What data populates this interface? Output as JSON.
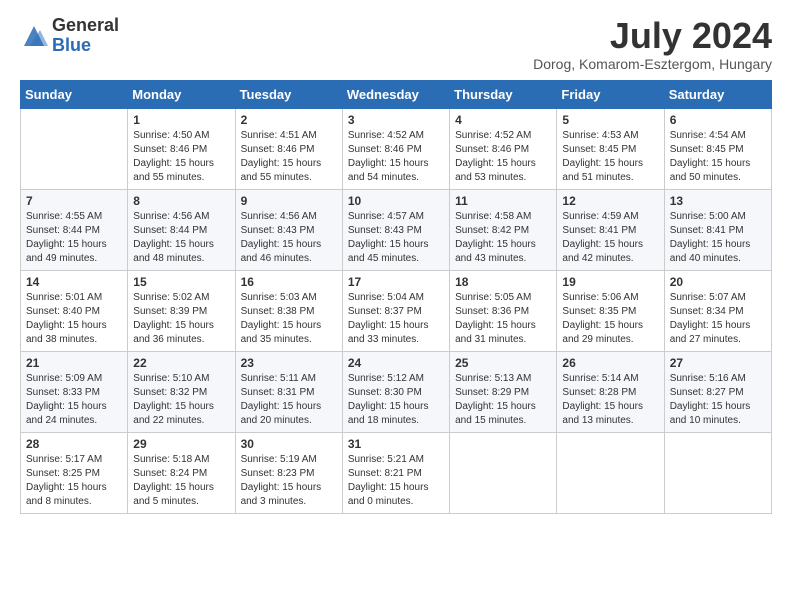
{
  "header": {
    "logo_general": "General",
    "logo_blue": "Blue",
    "month_year": "July 2024",
    "location": "Dorog, Komarom-Esztergom, Hungary"
  },
  "weekdays": [
    "Sunday",
    "Monday",
    "Tuesday",
    "Wednesday",
    "Thursday",
    "Friday",
    "Saturday"
  ],
  "weeks": [
    [
      {
        "day": "",
        "info": ""
      },
      {
        "day": "1",
        "info": "Sunrise: 4:50 AM\nSunset: 8:46 PM\nDaylight: 15 hours\nand 55 minutes."
      },
      {
        "day": "2",
        "info": "Sunrise: 4:51 AM\nSunset: 8:46 PM\nDaylight: 15 hours\nand 55 minutes."
      },
      {
        "day": "3",
        "info": "Sunrise: 4:52 AM\nSunset: 8:46 PM\nDaylight: 15 hours\nand 54 minutes."
      },
      {
        "day": "4",
        "info": "Sunrise: 4:52 AM\nSunset: 8:46 PM\nDaylight: 15 hours\nand 53 minutes."
      },
      {
        "day": "5",
        "info": "Sunrise: 4:53 AM\nSunset: 8:45 PM\nDaylight: 15 hours\nand 51 minutes."
      },
      {
        "day": "6",
        "info": "Sunrise: 4:54 AM\nSunset: 8:45 PM\nDaylight: 15 hours\nand 50 minutes."
      }
    ],
    [
      {
        "day": "7",
        "info": "Sunrise: 4:55 AM\nSunset: 8:44 PM\nDaylight: 15 hours\nand 49 minutes."
      },
      {
        "day": "8",
        "info": "Sunrise: 4:56 AM\nSunset: 8:44 PM\nDaylight: 15 hours\nand 48 minutes."
      },
      {
        "day": "9",
        "info": "Sunrise: 4:56 AM\nSunset: 8:43 PM\nDaylight: 15 hours\nand 46 minutes."
      },
      {
        "day": "10",
        "info": "Sunrise: 4:57 AM\nSunset: 8:43 PM\nDaylight: 15 hours\nand 45 minutes."
      },
      {
        "day": "11",
        "info": "Sunrise: 4:58 AM\nSunset: 8:42 PM\nDaylight: 15 hours\nand 43 minutes."
      },
      {
        "day": "12",
        "info": "Sunrise: 4:59 AM\nSunset: 8:41 PM\nDaylight: 15 hours\nand 42 minutes."
      },
      {
        "day": "13",
        "info": "Sunrise: 5:00 AM\nSunset: 8:41 PM\nDaylight: 15 hours\nand 40 minutes."
      }
    ],
    [
      {
        "day": "14",
        "info": "Sunrise: 5:01 AM\nSunset: 8:40 PM\nDaylight: 15 hours\nand 38 minutes."
      },
      {
        "day": "15",
        "info": "Sunrise: 5:02 AM\nSunset: 8:39 PM\nDaylight: 15 hours\nand 36 minutes."
      },
      {
        "day": "16",
        "info": "Sunrise: 5:03 AM\nSunset: 8:38 PM\nDaylight: 15 hours\nand 35 minutes."
      },
      {
        "day": "17",
        "info": "Sunrise: 5:04 AM\nSunset: 8:37 PM\nDaylight: 15 hours\nand 33 minutes."
      },
      {
        "day": "18",
        "info": "Sunrise: 5:05 AM\nSunset: 8:36 PM\nDaylight: 15 hours\nand 31 minutes."
      },
      {
        "day": "19",
        "info": "Sunrise: 5:06 AM\nSunset: 8:35 PM\nDaylight: 15 hours\nand 29 minutes."
      },
      {
        "day": "20",
        "info": "Sunrise: 5:07 AM\nSunset: 8:34 PM\nDaylight: 15 hours\nand 27 minutes."
      }
    ],
    [
      {
        "day": "21",
        "info": "Sunrise: 5:09 AM\nSunset: 8:33 PM\nDaylight: 15 hours\nand 24 minutes."
      },
      {
        "day": "22",
        "info": "Sunrise: 5:10 AM\nSunset: 8:32 PM\nDaylight: 15 hours\nand 22 minutes."
      },
      {
        "day": "23",
        "info": "Sunrise: 5:11 AM\nSunset: 8:31 PM\nDaylight: 15 hours\nand 20 minutes."
      },
      {
        "day": "24",
        "info": "Sunrise: 5:12 AM\nSunset: 8:30 PM\nDaylight: 15 hours\nand 18 minutes."
      },
      {
        "day": "25",
        "info": "Sunrise: 5:13 AM\nSunset: 8:29 PM\nDaylight: 15 hours\nand 15 minutes."
      },
      {
        "day": "26",
        "info": "Sunrise: 5:14 AM\nSunset: 8:28 PM\nDaylight: 15 hours\nand 13 minutes."
      },
      {
        "day": "27",
        "info": "Sunrise: 5:16 AM\nSunset: 8:27 PM\nDaylight: 15 hours\nand 10 minutes."
      }
    ],
    [
      {
        "day": "28",
        "info": "Sunrise: 5:17 AM\nSunset: 8:25 PM\nDaylight: 15 hours\nand 8 minutes."
      },
      {
        "day": "29",
        "info": "Sunrise: 5:18 AM\nSunset: 8:24 PM\nDaylight: 15 hours\nand 5 minutes."
      },
      {
        "day": "30",
        "info": "Sunrise: 5:19 AM\nSunset: 8:23 PM\nDaylight: 15 hours\nand 3 minutes."
      },
      {
        "day": "31",
        "info": "Sunrise: 5:21 AM\nSunset: 8:21 PM\nDaylight: 15 hours\nand 0 minutes."
      },
      {
        "day": "",
        "info": ""
      },
      {
        "day": "",
        "info": ""
      },
      {
        "day": "",
        "info": ""
      }
    ]
  ]
}
